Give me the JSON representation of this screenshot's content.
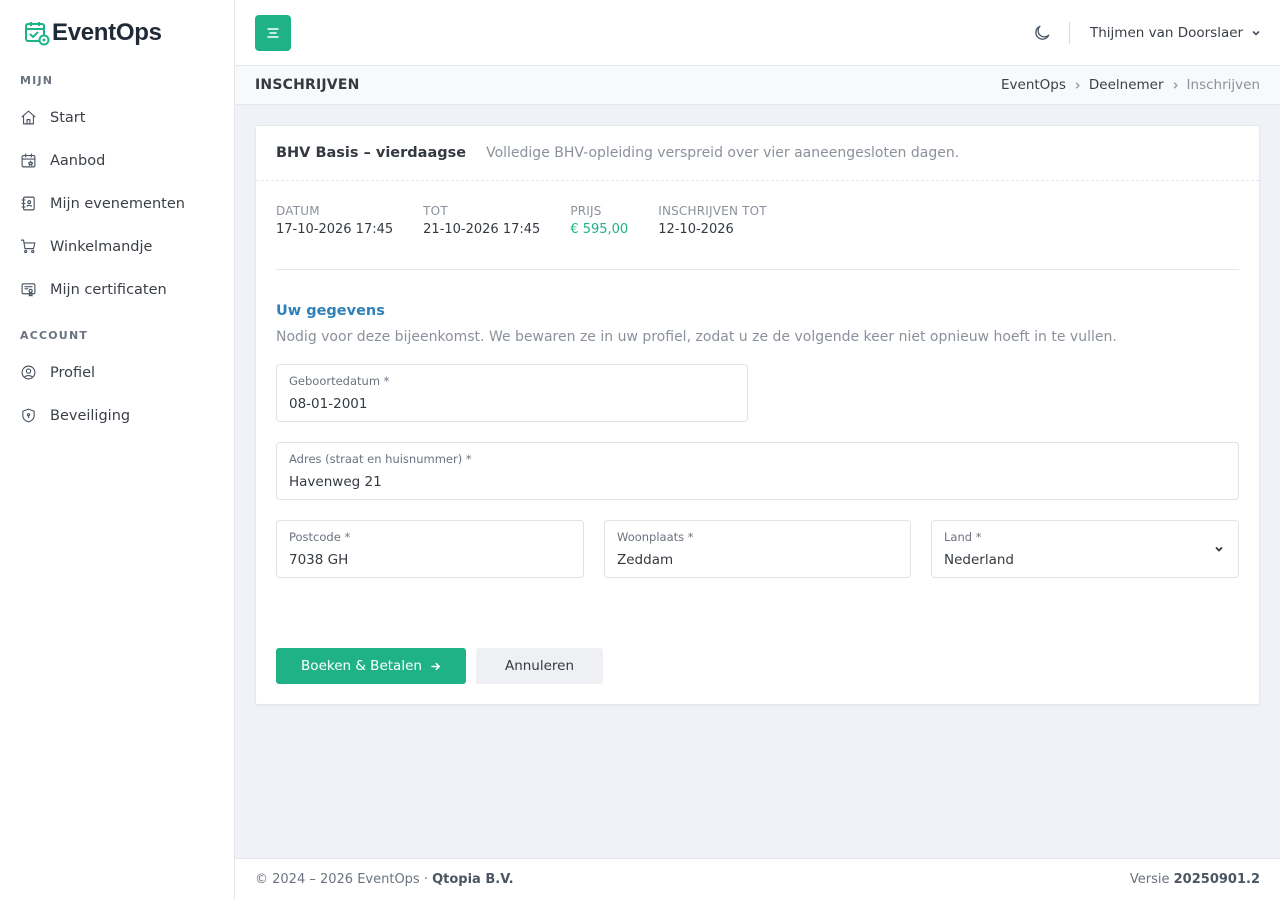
{
  "app": {
    "name": "EventOps"
  },
  "sidebar": {
    "section_mijn": "MIJN",
    "items_mijn": [
      {
        "label": "Start",
        "icon": "home-icon"
      },
      {
        "label": "Aanbod",
        "icon": "calendar-star-icon"
      },
      {
        "label": "Mijn evenementen",
        "icon": "agenda-icon"
      },
      {
        "label": "Winkelmandje",
        "icon": "cart-icon"
      },
      {
        "label": "Mijn certificaten",
        "icon": "certificate-icon"
      }
    ],
    "section_account": "ACCOUNT",
    "items_account": [
      {
        "label": "Profiel",
        "icon": "user-circle-icon"
      },
      {
        "label": "Beveiliging",
        "icon": "shield-icon"
      }
    ]
  },
  "topbar": {
    "user_name": "Thijmen van Doorslaer"
  },
  "pagebar": {
    "title": "INSCHRIJVEN",
    "breadcrumb": [
      "EventOps",
      "Deelnemer",
      "Inschrijven"
    ]
  },
  "course": {
    "title": "BHV Basis – vierdaagse",
    "description": "Volledige BHV-opleiding verspreid over vier aaneengesloten dagen.",
    "meta": [
      {
        "label": "DATUM",
        "value": "17-10-2026 17:45"
      },
      {
        "label": "TOT",
        "value": "21-10-2026 17:45"
      },
      {
        "label": "PRIJS",
        "value": "€ 595,00"
      },
      {
        "label": "INSCHRIJVEN TOT",
        "value": "12-10-2026"
      }
    ]
  },
  "form": {
    "section_title": "Uw gegevens",
    "section_desc": "Nodig voor deze bijeenkomst. We bewaren ze in uw profiel, zodat u ze de volgende keer niet opnieuw hoeft in te vullen.",
    "birthdate": {
      "label": "Geboortedatum *",
      "value": "08-01-2001"
    },
    "address": {
      "label": "Adres (straat en huisnummer) *",
      "value": "Havenweg 21"
    },
    "postcode": {
      "label": "Postcode *",
      "value": "7038 GH"
    },
    "city": {
      "label": "Woonplaats *",
      "value": "Zeddam"
    },
    "country": {
      "label": "Land *",
      "value": "Nederland"
    },
    "submit_label": "Boeken & Betalen",
    "cancel_label": "Annuleren"
  },
  "footer": {
    "copyright": "© 2024 – 2026 EventOps · ",
    "company": "Qtopia B.V.",
    "version_label": "Versie ",
    "version": "20250901.2"
  },
  "colors": {
    "accent": "#1fb287",
    "link": "#2f7fb8"
  }
}
